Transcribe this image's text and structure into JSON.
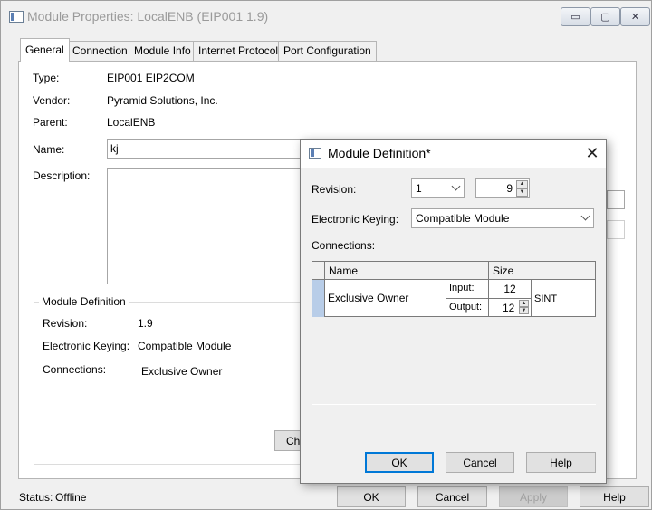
{
  "window": {
    "title": "Module Properties: LocalENB (EIP001 1.9)",
    "minimize": "▭",
    "maximize": "▢",
    "close": "✕"
  },
  "tabs": [
    "General",
    "Connection",
    "Module Info",
    "Internet Protocol",
    "Port Configuration"
  ],
  "general": {
    "type_label": "Type:",
    "type_value": "EIP001 EIP2COM",
    "vendor_label": "Vendor:",
    "vendor_value": "Pyramid Solutions, Inc.",
    "parent_label": "Parent:",
    "parent_value": "LocalENB",
    "name_label": "Name:",
    "name_value": "kj",
    "description_label": "Description:",
    "description_value": "",
    "module_definition": {
      "title": "Module Definition",
      "revision_label": "Revision:",
      "revision_value": "1.9",
      "keying_label": "Electronic Keying:",
      "keying_value": "Compatible Module",
      "connections_label": "Connections:",
      "connections_value": "Exclusive Owner",
      "change_button": "Ch"
    }
  },
  "status": {
    "label": "Status:",
    "value": "Offline"
  },
  "buttons": {
    "ok": "OK",
    "cancel": "Cancel",
    "apply": "Apply",
    "help": "Help"
  },
  "dialog": {
    "title": "Module Definition*",
    "close": "✕",
    "revision_label": "Revision:",
    "revision_major": "1",
    "revision_minor": "9",
    "keying_label": "Electronic Keying:",
    "keying_value": "Compatible Module",
    "connections_label": "Connections:",
    "grid": {
      "col_name": "Name",
      "col_size": "Size",
      "row": {
        "name": "Exclusive Owner",
        "input_label": "Input:",
        "input_value": "12",
        "output_label": "Output:",
        "output_value": "12",
        "unit": "SINT"
      }
    },
    "ok": "OK",
    "cancel": "Cancel",
    "help": "Help"
  }
}
